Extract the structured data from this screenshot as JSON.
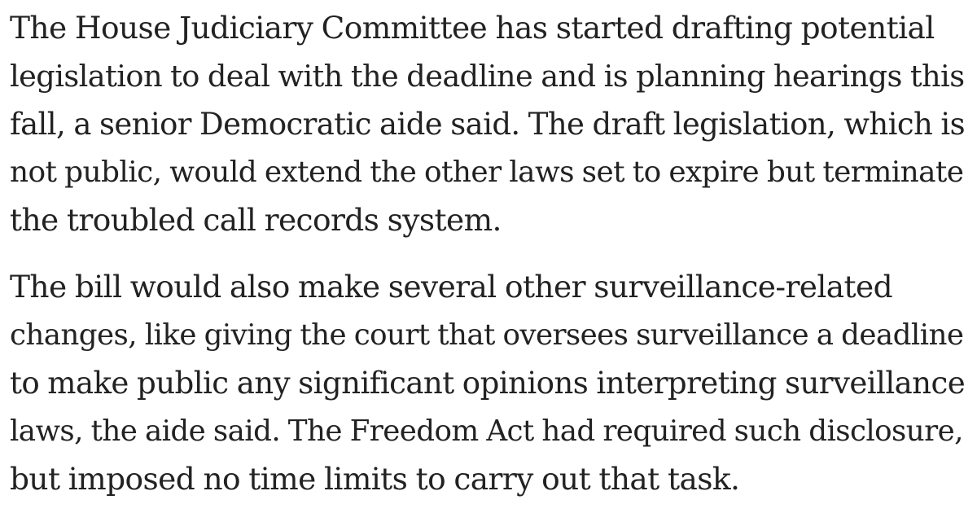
{
  "article": {
    "paragraphs": [
      {
        "lines": [
          "The House Judiciary Committee has started drafting potential",
          "legislation to deal with the deadline and is planning hearings this",
          "fall, a senior Democratic aide said. The draft legislation, which is",
          "not public, would extend the other laws set to expire but terminate",
          "the troubled call records system."
        ]
      },
      {
        "lines": [
          "The bill would also make several other surveillance-related",
          "changes, like giving the court that oversees surveillance a deadline",
          "to make public any significant opinions interpreting surveillance",
          "laws, the aide said. The Freedom Act had required such disclosure,",
          "but imposed no time limits to carry out that task."
        ]
      }
    ]
  }
}
